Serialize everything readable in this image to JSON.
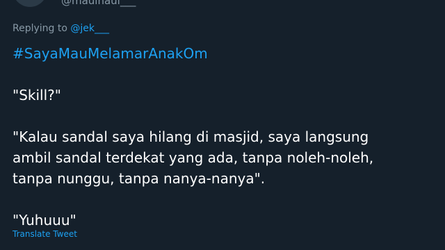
{
  "tweet": {
    "handle": "@maulhaul___",
    "replying_prefix": "Replying to",
    "replying_to": "@jek___",
    "hashtag": "#SayaMauMelamarAnakOm",
    "paragraphs": [
      "\"Skill?\"",
      "\"Kalau sandal saya hilang di masjid, saya langsung",
      "ambil sandal terdekat yang ada, tanpa noleh-noleh,",
      "tanpa nunggu, tanpa nanya-nanya\".",
      "\"Yuhuuu\""
    ],
    "translate_label": "Translate Tweet"
  },
  "colors": {
    "background": "#15202b",
    "text": "#ffffff",
    "muted": "#8899a6",
    "link": "#1da1f2"
  }
}
